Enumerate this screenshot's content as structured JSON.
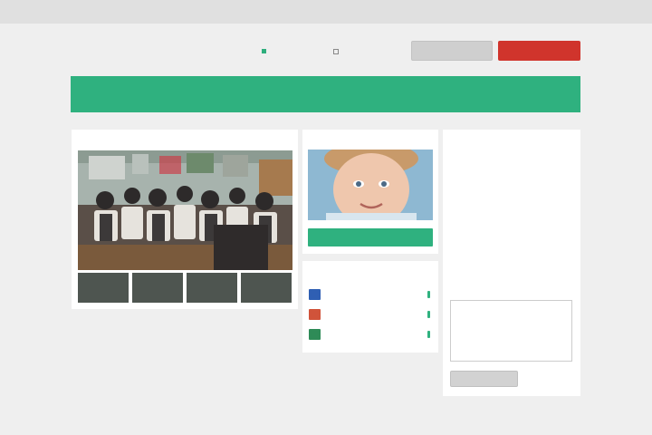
{
  "header": {
    "logo": "",
    "user_link": ""
  },
  "info": {
    "teacher_label": "",
    "teacher_value": "",
    "subject_label": "",
    "subject_value": ""
  },
  "actions": {
    "flag_label": "",
    "checkbox_label": "",
    "secondary_button": "",
    "primary_button": ""
  },
  "banner": {
    "line1": "",
    "line2": ""
  },
  "video": {
    "title": ""
  },
  "participant": {
    "title": "",
    "button": ""
  },
  "materials": {
    "title": "",
    "items": [
      {
        "type": "word-icon",
        "name": ""
      },
      {
        "type": "pdf-icon",
        "name": ""
      },
      {
        "type": "excel-icon",
        "name": ""
      }
    ]
  },
  "messages": {
    "title": "",
    "items": [
      {
        "date": "",
        "author": "",
        "text": ""
      },
      {
        "date": "",
        "author": "",
        "text": ""
      }
    ]
  },
  "compose": {
    "title": "",
    "button": ""
  },
  "colors": {
    "accent": "#2fb17f",
    "danger": "#d0342c",
    "link": "#4a7fd0"
  }
}
